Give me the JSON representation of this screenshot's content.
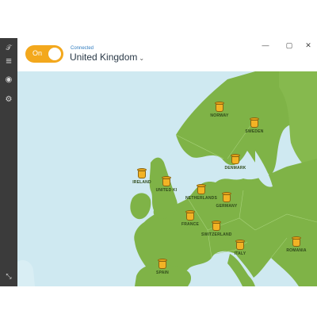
{
  "header": {
    "toggle_label": "On",
    "status": "Connected",
    "country": "United Kingdom"
  },
  "sidebar": {
    "items": [
      {
        "name": "logo",
        "glyph": "𝒯"
      },
      {
        "name": "menu",
        "glyph": "≡"
      },
      {
        "name": "map",
        "glyph": "◉"
      },
      {
        "name": "settings",
        "glyph": "⚙"
      },
      {
        "name": "collapse",
        "glyph": "⤡"
      }
    ]
  },
  "window_controls": {
    "minimize": "—",
    "maximize": "▢",
    "close": "✕"
  },
  "pins": [
    {
      "id": "norway",
      "label": "NORWAY"
    },
    {
      "id": "sweden",
      "label": "SWEDEN"
    },
    {
      "id": "denmark",
      "label": "DENMARK"
    },
    {
      "id": "ireland",
      "label": "IRELAND"
    },
    {
      "id": "uk",
      "label": "UNITED KI"
    },
    {
      "id": "netherlands",
      "label": "NETHERLANDS"
    },
    {
      "id": "germany",
      "label": "GERMANY"
    },
    {
      "id": "france",
      "label": "FRANCE"
    },
    {
      "id": "switzerland",
      "label": "SWITZERLAND"
    },
    {
      "id": "italy",
      "label": "ITALY"
    },
    {
      "id": "spain",
      "label": "SPAIN"
    },
    {
      "id": "romania",
      "label": "ROMANIA"
    }
  ],
  "colors": {
    "accent": "#f3a81d",
    "sea": "#cfe9f1",
    "land": "#7fb347",
    "sidebar": "#3b3b3b"
  }
}
